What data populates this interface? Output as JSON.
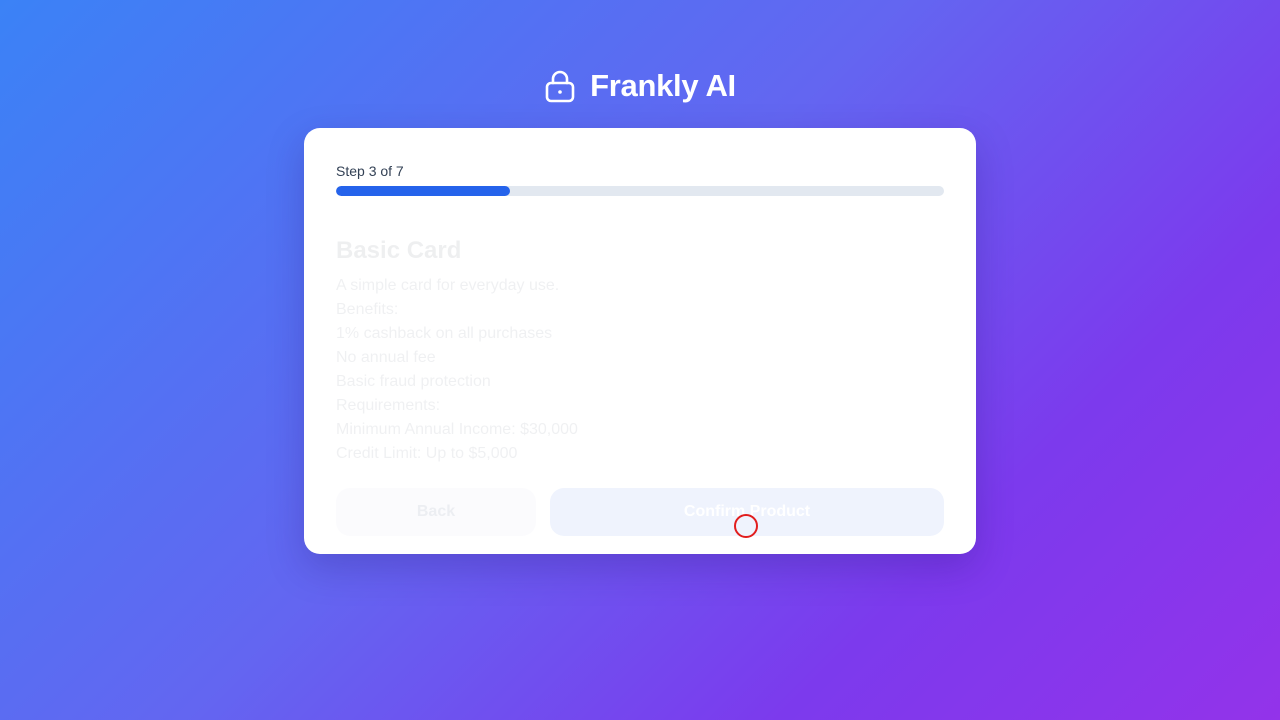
{
  "app": {
    "title": "Frankly AI",
    "logo_icon": "lock-icon"
  },
  "progress": {
    "label": "Step 3 of 7",
    "current_step": 3,
    "total_steps": 7,
    "fraction": 0.2857,
    "color": "#2563eb"
  },
  "product": {
    "title": "Basic Card",
    "description": "A simple card for everyday use.",
    "benefits_heading": "Benefits:",
    "benefits": [
      "1% cashback on all purchases",
      "No annual fee",
      "Basic fraud protection"
    ],
    "requirements_heading": "Requirements:",
    "requirements": [
      "Minimum Annual Income: $30,000",
      "Credit Limit: Up to $5,000"
    ]
  },
  "actions": {
    "back_label": "Back",
    "confirm_label": "Confirm Product"
  },
  "colors": {
    "accent": "#2563eb",
    "cursor_marker": "#e11d1d"
  }
}
